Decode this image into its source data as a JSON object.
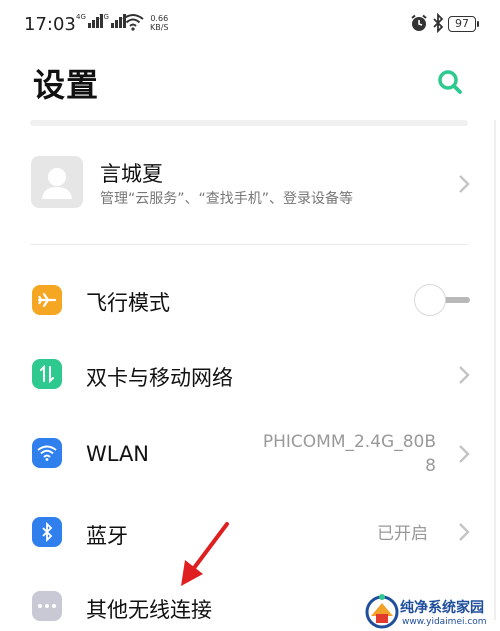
{
  "status_bar": {
    "time": "17:03",
    "sim1_tag": "4G",
    "sim2_tag": "2G",
    "net_speed_value": "0.66",
    "net_speed_unit": "KB/S",
    "battery": "97"
  },
  "header": {
    "title": "设置",
    "search_icon": "search-icon"
  },
  "account": {
    "name": "言城夏",
    "subtitle": "管理“云服务”、“查找手机”、登录设备等"
  },
  "rows": [
    {
      "label": "飞行模式",
      "icon": "airplane-icon",
      "color": "#f5a623",
      "control": "toggle",
      "toggle_on": false
    },
    {
      "label": "双卡与移动网络",
      "icon": "dual-sim-icon",
      "color": "#2ec98f",
      "control": "chevron"
    },
    {
      "label": "WLAN",
      "icon": "wifi-icon",
      "color": "#2f80ed",
      "value_line1": "PHICOMM_2.4G_80B",
      "value_line2": "8",
      "control": "chevron"
    },
    {
      "label": "蓝牙",
      "icon": "bluetooth-icon",
      "color": "#2f80ed",
      "value_line1": "已开启",
      "control": "chevron"
    },
    {
      "label": "其他无线连接",
      "icon": "more-dots-icon",
      "color": "#c9c9d6",
      "control": "none"
    }
  ],
  "watermark": {
    "text": "纯净系统家园",
    "url": "www.yidaimei.com"
  },
  "colors": {
    "accent": "#2ec98f",
    "text_primary": "#111111",
    "text_secondary": "#777777",
    "value_gray": "#999999"
  }
}
